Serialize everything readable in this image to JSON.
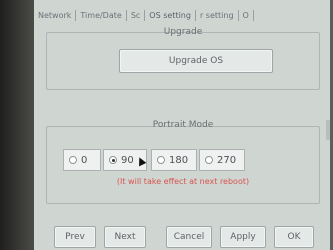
{
  "tabs": [
    "Network",
    "Time/Date",
    "Sc",
    "OS setting",
    "r setting",
    "O"
  ],
  "upgrade": {
    "title": "Upgrade",
    "button": "Upgrade OS"
  },
  "portrait": {
    "title": "Portrait Mode",
    "options": [
      "0",
      "90",
      "180",
      "270"
    ],
    "selected": "90",
    "note": "(It will take effect at next reboot)"
  },
  "footer": {
    "prev": "Prev",
    "next": "Next",
    "cancel": "Cancel",
    "apply": "Apply",
    "ok": "OK"
  }
}
